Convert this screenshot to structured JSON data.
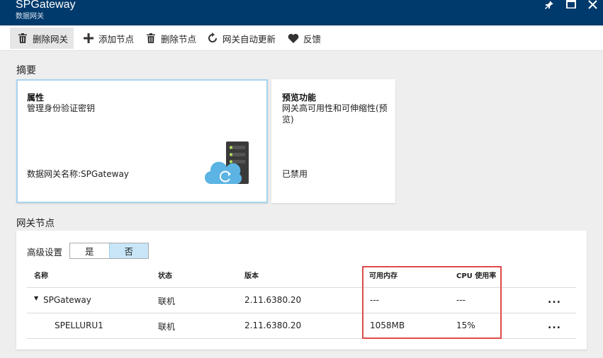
{
  "window": {
    "title": "SPGateway",
    "subtitle": "数据网关"
  },
  "toolbar": {
    "delete_gateway": "删除网关",
    "add_node": "添加节点",
    "delete_node": "删除节点",
    "auto_update": "网关自动更新",
    "feedback": "反馈"
  },
  "summary": {
    "heading": "摘要",
    "properties": {
      "title": "属性",
      "desc": "管理身份验证密钥",
      "name_line": "数据网关名称:SPGateway"
    },
    "preview": {
      "title": "预览功能",
      "desc": "网关高可用性和可伸缩性(预览)",
      "status": "已禁用"
    }
  },
  "nodes": {
    "heading": "网关节点",
    "advanced_label": "高级设置",
    "toggle_yes": "是",
    "toggle_no": "否",
    "toggle_selected": "否",
    "columns": [
      "名称",
      "状态",
      "版本",
      "可用内存",
      "CPU 使用率"
    ],
    "rows": [
      {
        "name": "SPGateway",
        "status": "联机",
        "version": "2.11.6380.20",
        "memory": "---",
        "cpu": "---",
        "more": "..."
      },
      {
        "name": "SPELLURU1",
        "status": "联机",
        "version": "2.11.6380.20",
        "memory": "1058MB",
        "cpu": "15%",
        "more": "..."
      }
    ]
  },
  "colors": {
    "titlebar": "#003a6c",
    "selected_tile_border": "#a9d3ef",
    "toggle_selected": "#c8e6f8",
    "highlight_box": "#e04a4a",
    "cloud": "#5bb4e3"
  },
  "icons": [
    "pin-icon",
    "maximize-icon",
    "close-icon",
    "trash-icon",
    "plus-icon",
    "refresh-icon",
    "heart-icon",
    "gateway-server-cloud-icon",
    "caret-down-icon"
  ]
}
